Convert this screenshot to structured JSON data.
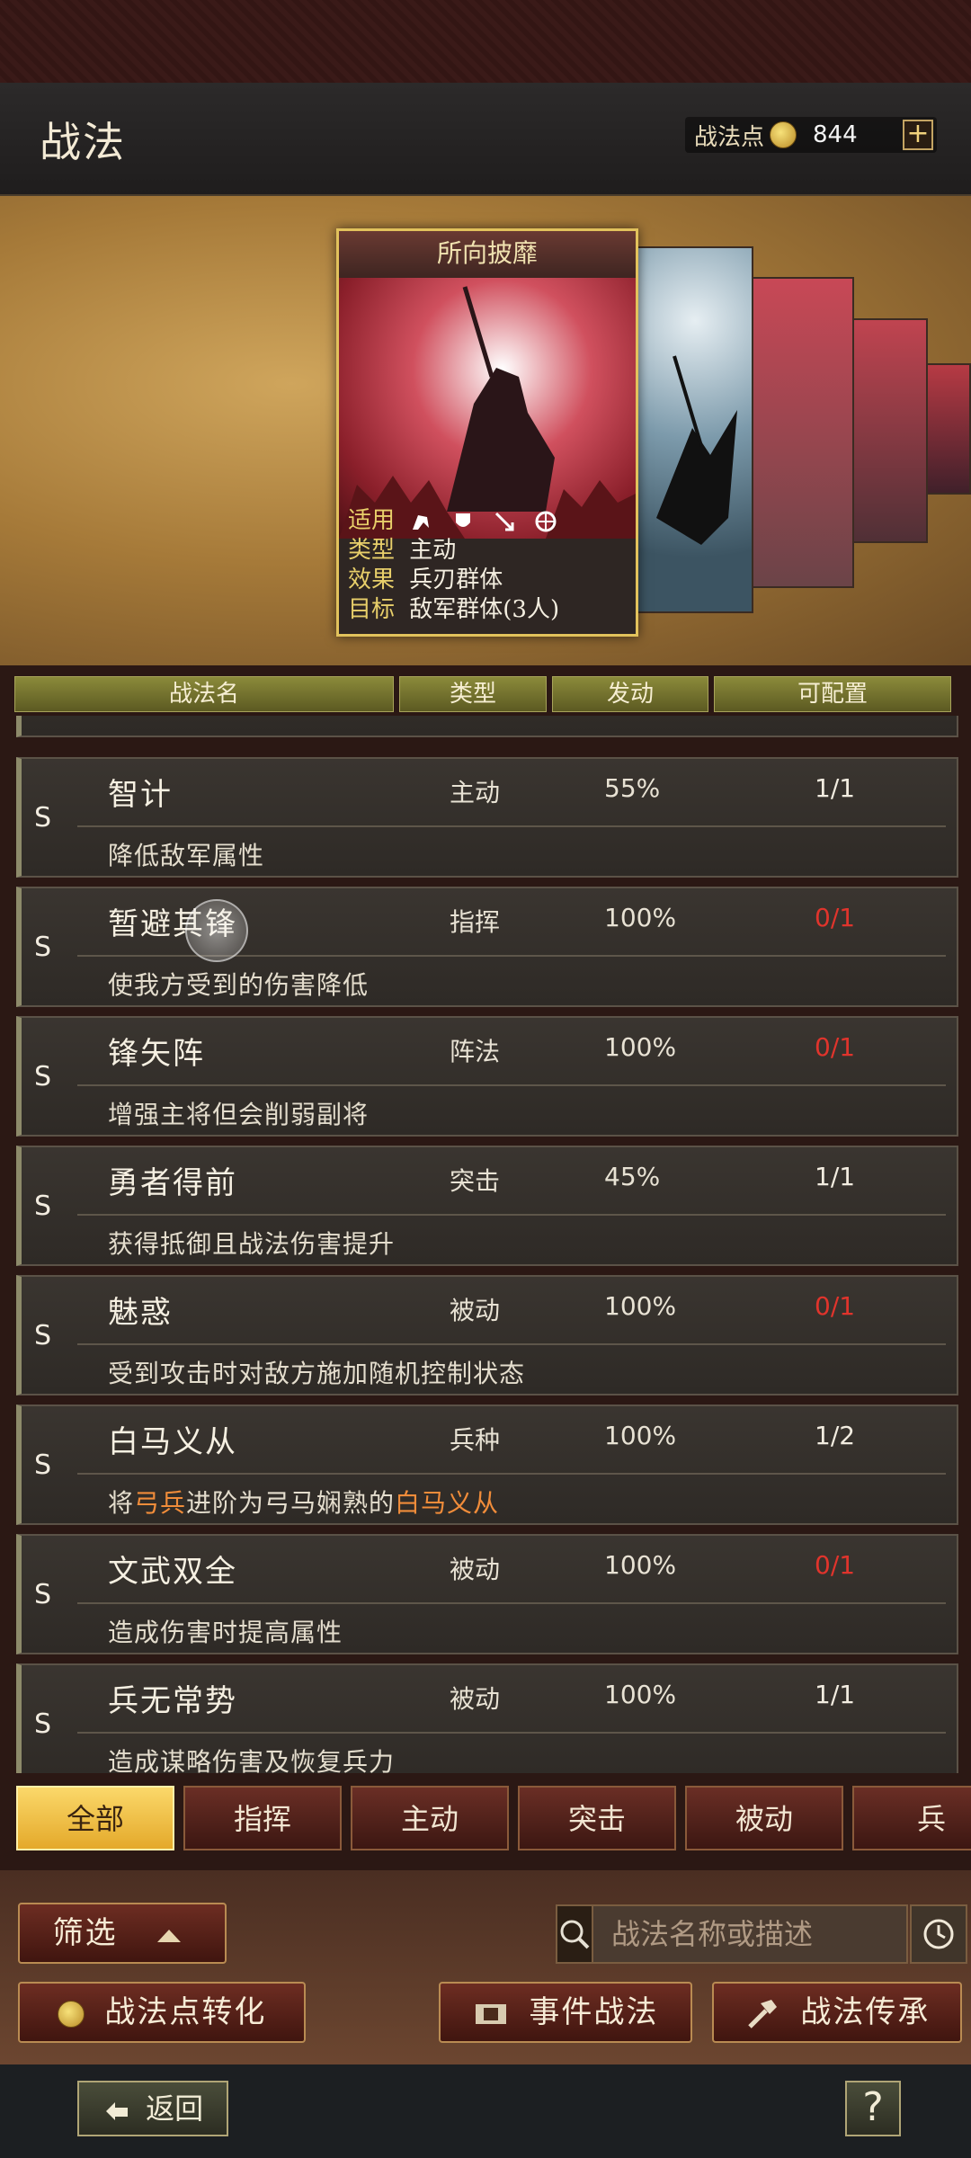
{
  "header": {
    "title": "战法",
    "points_label": "战法点",
    "points_value": "844",
    "plus_label": "+"
  },
  "featured_card": {
    "title": "所向披靡",
    "labels": {
      "apply": "适用",
      "type": "类型",
      "effect": "效果",
      "target": "目标"
    },
    "type": "主动",
    "effect": "兵刃群体",
    "target": "敌军群体(3人)",
    "apply_icons": [
      "cavalry-icon",
      "shield-icon",
      "archer-icon",
      "chariot-icon"
    ]
  },
  "table_header": {
    "name": "战法名",
    "type": "类型",
    "rate": "发动",
    "config": "可配置"
  },
  "rows": [
    {
      "grade": "S",
      "name": "智计",
      "type": "主动",
      "rate": "55%",
      "config": "1/1",
      "config_status": "ok",
      "desc": "降低敌军属性"
    },
    {
      "grade": "S",
      "name": "暂避其锋",
      "type": "指挥",
      "rate": "100%",
      "config": "0/1",
      "config_status": "red",
      "desc": "使我方受到的伤害降低"
    },
    {
      "grade": "S",
      "name": "锋矢阵",
      "type": "阵法",
      "rate": "100%",
      "config": "0/1",
      "config_status": "red",
      "desc": "增强主将但会削弱副将"
    },
    {
      "grade": "S",
      "name": "勇者得前",
      "type": "突击",
      "rate": "45%",
      "config": "1/1",
      "config_status": "ok",
      "desc": "获得抵御且战法伤害提升"
    },
    {
      "grade": "S",
      "name": "魅惑",
      "type": "被动",
      "rate": "100%",
      "config": "0/1",
      "config_status": "red",
      "desc": "受到攻击时对敌方施加随机控制状态"
    },
    {
      "grade": "S",
      "name": "白马义从",
      "type": "兵种",
      "rate": "100%",
      "config": "1/2",
      "config_status": "ok",
      "desc_parts": [
        "将",
        "弓兵",
        "进阶为弓马娴熟的",
        "白马义从"
      ]
    },
    {
      "grade": "S",
      "name": "文武双全",
      "type": "被动",
      "rate": "100%",
      "config": "0/1",
      "config_status": "red",
      "desc": "造成伤害时提高属性"
    },
    {
      "grade": "S",
      "name": "兵无常势",
      "type": "被动",
      "rate": "100%",
      "config": "1/1",
      "config_status": "ok",
      "desc": "造成谋略伤害及恢复兵力"
    }
  ],
  "tabs": [
    "全部",
    "指挥",
    "主动",
    "突击",
    "被动",
    "兵"
  ],
  "active_tab": "全部",
  "controls": {
    "filter_label": "筛选",
    "search_placeholder": "战法名称或描述",
    "convert_label": "战法点转化",
    "event_label": "事件战法",
    "inherit_label": "战法传承"
  },
  "footer": {
    "back_label": "返回",
    "help_label": "?"
  },
  "colors": {
    "accent_gold": "#e2c25c",
    "config_red": "#e0342c",
    "highlight_orange": "#f08c3a",
    "active_tab": "#f6c445"
  }
}
